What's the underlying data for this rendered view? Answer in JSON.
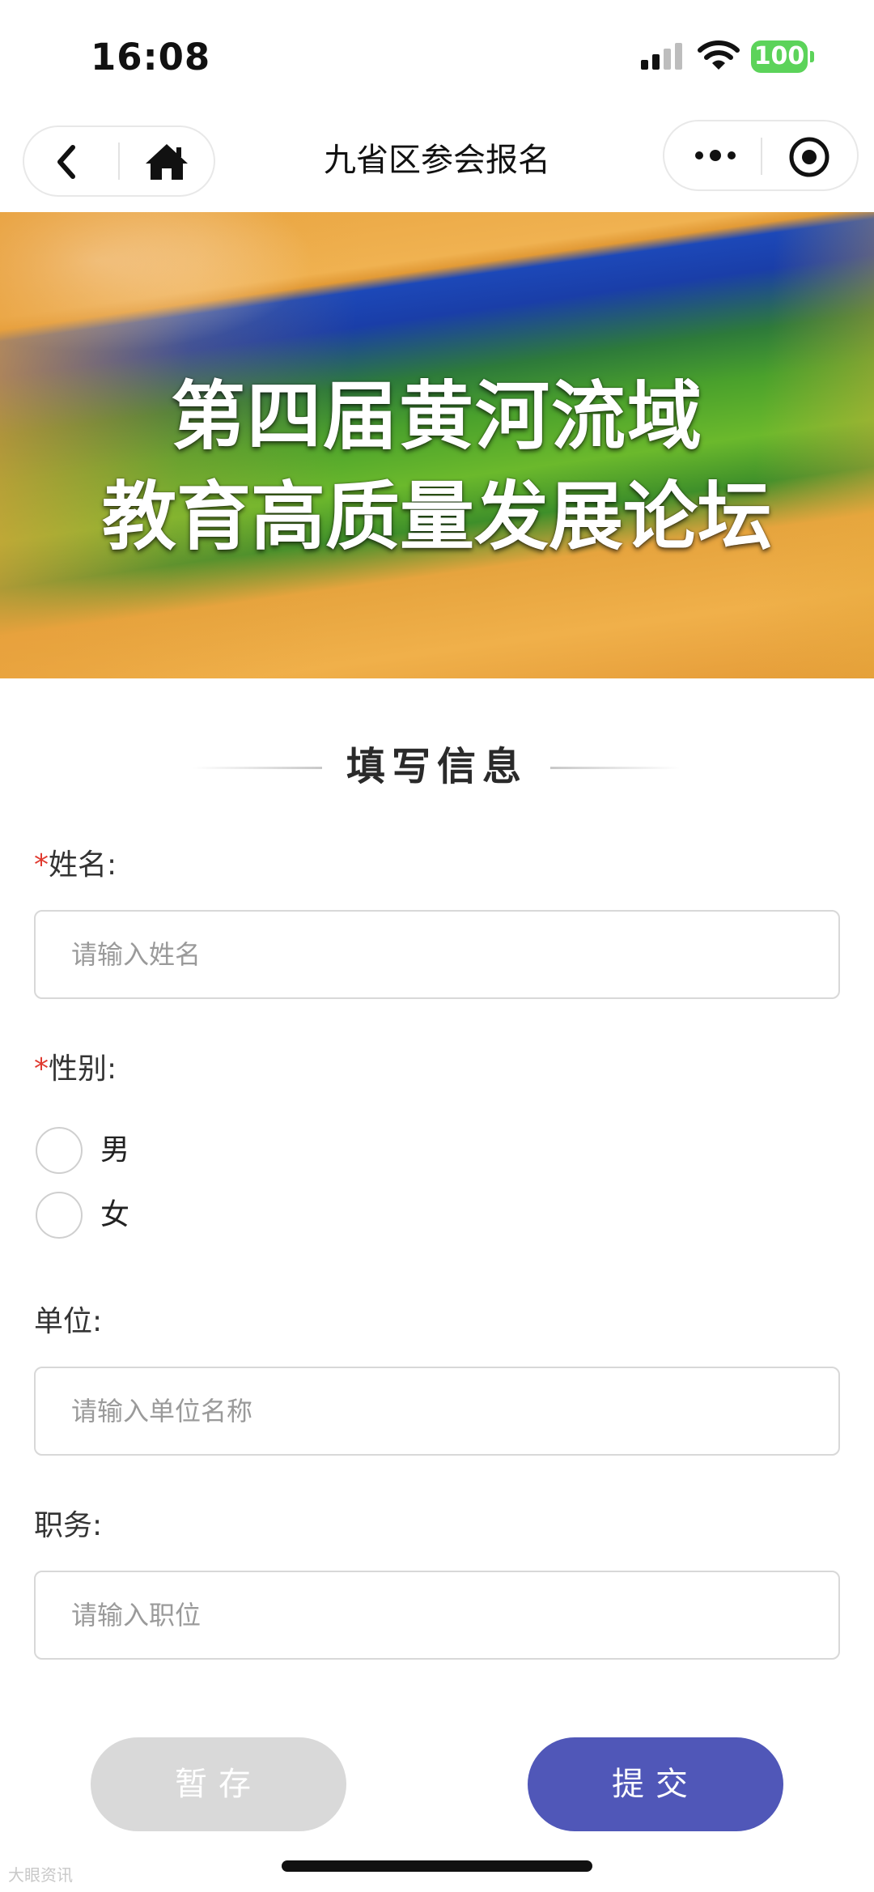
{
  "status_bar": {
    "time": "16:08",
    "battery": "100"
  },
  "nav": {
    "title": "九省区参会报名"
  },
  "banner": {
    "line1": "第四届黄河流域",
    "line2": "教育高质量发展论坛"
  },
  "section": {
    "heading": "填写信息"
  },
  "form": {
    "name": {
      "required_mark": "*",
      "label": "姓名:",
      "placeholder": "请输入姓名",
      "value": ""
    },
    "gender": {
      "required_mark": "*",
      "label": "性别:",
      "options": [
        "男",
        "女"
      ],
      "selected": null
    },
    "unit": {
      "label": "单位:",
      "placeholder": "请输入单位名称",
      "value": ""
    },
    "position": {
      "label": "职务:",
      "placeholder": "请输入职位",
      "value": ""
    }
  },
  "buttons": {
    "save": "暂存",
    "submit": "提交"
  },
  "watermark": "大眼资讯",
  "colors": {
    "submit": "#5057b8",
    "save_disabled": "#d9d9d9",
    "required": "#e03a2f",
    "battery": "#5cd35a"
  },
  "icons": [
    "signal-icon",
    "wifi-icon",
    "back-arrow-icon",
    "home-icon",
    "more-dots-icon",
    "target-icon"
  ]
}
